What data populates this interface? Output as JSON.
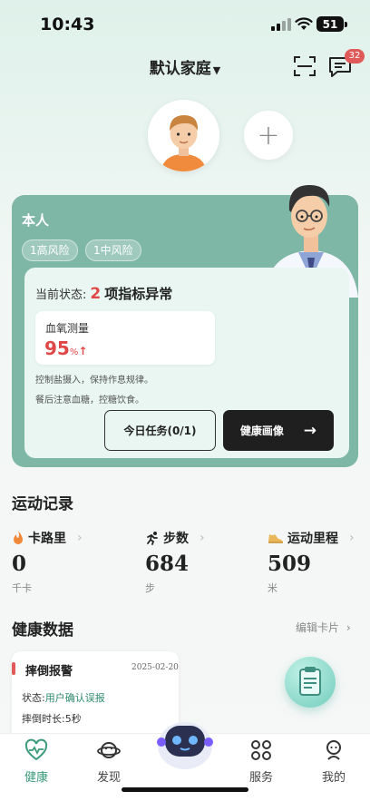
{
  "status_bar": {
    "time": "10:43",
    "battery": "51"
  },
  "header": {
    "family_title": "默认家庭",
    "message_badge": "32"
  },
  "health_card": {
    "person": "本人",
    "risk_tags": [
      "1高风险",
      "1中风险"
    ],
    "status_label": "当前状态:",
    "abnormal_count": "2",
    "abnormal_desc": "项指标异常",
    "metric": {
      "name": "血氧测量",
      "value": "95",
      "unit": "%",
      "trend": "↑"
    },
    "advice": [
      "控制盐摄入，保持作息规律。",
      "餐后注意血糖，控糖饮食。"
    ],
    "task_button": "今日任务(0/1)",
    "portrait_button": "健康画像"
  },
  "exercise": {
    "title": "运动记录",
    "items": [
      {
        "label": "卡路里",
        "value": "0",
        "unit": "千卡",
        "icon": "flame-icon"
      },
      {
        "label": "步数",
        "value": "684",
        "unit": "步",
        "icon": "running-icon"
      },
      {
        "label": "运动里程",
        "value": "509",
        "unit": "米",
        "icon": "shoe-icon"
      }
    ]
  },
  "health_data": {
    "title": "健康数据",
    "edit_label": "编辑卡片",
    "alert": {
      "title": "摔倒报警",
      "date": "2025-02-20",
      "status_label": "状态:",
      "status_value": "用户确认误报",
      "duration_label": "摔倒时长:",
      "duration_value": "5秒"
    }
  },
  "tabs": [
    {
      "label": "健康",
      "icon": "heart-pulse-icon",
      "active": true
    },
    {
      "label": "发现",
      "icon": "planet-icon",
      "active": false
    },
    {
      "label": "服务",
      "icon": "grid-icon",
      "active": false
    },
    {
      "label": "我的",
      "icon": "person-icon",
      "active": false
    }
  ],
  "colors": {
    "accent": "#3a9a7a",
    "alert_red": "#e04848",
    "card_green": "#7fb7a7"
  }
}
